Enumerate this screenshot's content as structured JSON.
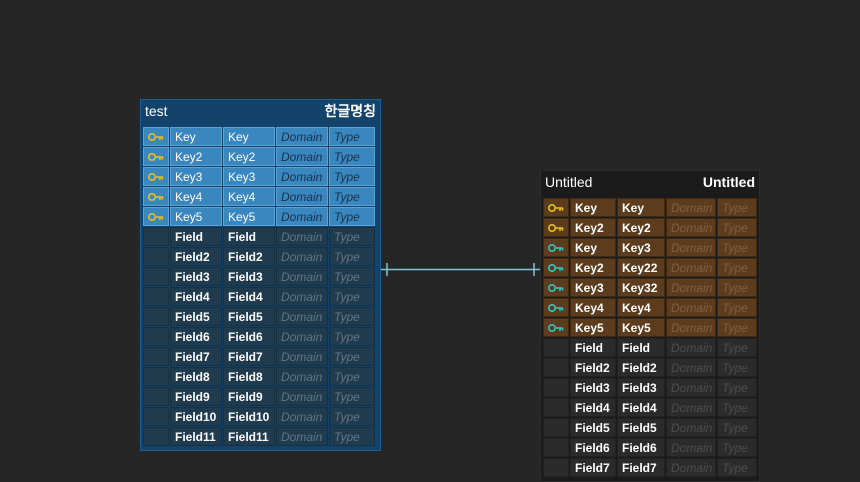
{
  "colors": {
    "background": "#262626",
    "relation_line": "#7ec6d6",
    "pk_key_icon": "#e6c21a",
    "fk_key_icon": "#2fc6c0",
    "selected_table": "#13436b",
    "pk_row_blue": "#3a86bf",
    "pk_row_brown": "#5c3c1c"
  },
  "tables": [
    {
      "name": "test",
      "comment": "한글명칭",
      "rows": [
        {
          "kind": "pk",
          "icon": "pk-key-icon",
          "logical": "Key",
          "physical": "Key",
          "domain": "Domain",
          "type": "Type"
        },
        {
          "kind": "pk",
          "icon": "pk-key-icon",
          "logical": "Key2",
          "physical": "Key2",
          "domain": "Domain",
          "type": "Type"
        },
        {
          "kind": "pk",
          "icon": "pk-key-icon",
          "logical": "Key3",
          "physical": "Key3",
          "domain": "Domain",
          "type": "Type"
        },
        {
          "kind": "pk",
          "icon": "pk-key-icon",
          "logical": "Key4",
          "physical": "Key4",
          "domain": "Domain",
          "type": "Type"
        },
        {
          "kind": "pk",
          "icon": "pk-key-icon",
          "logical": "Key5",
          "physical": "Key5",
          "domain": "Domain",
          "type": "Type"
        },
        {
          "kind": "field",
          "icon": "",
          "logical": "Field",
          "physical": "Field",
          "domain": "Domain",
          "type": "Type"
        },
        {
          "kind": "field",
          "icon": "",
          "logical": "Field2",
          "physical": "Field2",
          "domain": "Domain",
          "type": "Type"
        },
        {
          "kind": "field",
          "icon": "",
          "logical": "Field3",
          "physical": "Field3",
          "domain": "Domain",
          "type": "Type"
        },
        {
          "kind": "field",
          "icon": "",
          "logical": "Field4",
          "physical": "Field4",
          "domain": "Domain",
          "type": "Type"
        },
        {
          "kind": "field",
          "icon": "",
          "logical": "Field5",
          "physical": "Field5",
          "domain": "Domain",
          "type": "Type"
        },
        {
          "kind": "field",
          "icon": "",
          "logical": "Field6",
          "physical": "Field6",
          "domain": "Domain",
          "type": "Type"
        },
        {
          "kind": "field",
          "icon": "",
          "logical": "Field7",
          "physical": "Field7",
          "domain": "Domain",
          "type": "Type"
        },
        {
          "kind": "field",
          "icon": "",
          "logical": "Field8",
          "physical": "Field8",
          "domain": "Domain",
          "type": "Type"
        },
        {
          "kind": "field",
          "icon": "",
          "logical": "Field9",
          "physical": "Field9",
          "domain": "Domain",
          "type": "Type"
        },
        {
          "kind": "field",
          "icon": "",
          "logical": "Field10",
          "physical": "Field10",
          "domain": "Domain",
          "type": "Type"
        },
        {
          "kind": "field",
          "icon": "",
          "logical": "Field11",
          "physical": "Field11",
          "domain": "Domain",
          "type": "Type"
        }
      ]
    },
    {
      "name": "Untitled",
      "comment": "Untitled",
      "rows": [
        {
          "kind": "pk",
          "icon": "pk-key-icon",
          "logical": "Key",
          "physical": "Key",
          "domain": "Domain",
          "type": "Type"
        },
        {
          "kind": "pk",
          "icon": "pk-key-icon",
          "logical": "Key2",
          "physical": "Key2",
          "domain": "Domain",
          "type": "Type"
        },
        {
          "kind": "pk",
          "icon": "pfk-key-icon",
          "logical": "Key",
          "physical": "Key3",
          "domain": "Domain",
          "type": "Type"
        },
        {
          "kind": "pk",
          "icon": "pfk-key-icon",
          "logical": "Key2",
          "physical": "Key22",
          "domain": "Domain",
          "type": "Type"
        },
        {
          "kind": "pk",
          "icon": "pfk-key-icon",
          "logical": "Key3",
          "physical": "Key32",
          "domain": "Domain",
          "type": "Type"
        },
        {
          "kind": "pk",
          "icon": "pfk-key-icon",
          "logical": "Key4",
          "physical": "Key4",
          "domain": "Domain",
          "type": "Type"
        },
        {
          "kind": "pk",
          "icon": "pfk-key-icon",
          "logical": "Key5",
          "physical": "Key5",
          "domain": "Domain",
          "type": "Type"
        },
        {
          "kind": "field",
          "icon": "",
          "logical": "Field",
          "physical": "Field",
          "domain": "Domain",
          "type": "Type"
        },
        {
          "kind": "field",
          "icon": "",
          "logical": "Field2",
          "physical": "Field2",
          "domain": "Domain",
          "type": "Type"
        },
        {
          "kind": "field",
          "icon": "",
          "logical": "Field3",
          "physical": "Field3",
          "domain": "Domain",
          "type": "Type"
        },
        {
          "kind": "field",
          "icon": "",
          "logical": "Field4",
          "physical": "Field4",
          "domain": "Domain",
          "type": "Type"
        },
        {
          "kind": "field",
          "icon": "",
          "logical": "Field5",
          "physical": "Field5",
          "domain": "Domain",
          "type": "Type"
        },
        {
          "kind": "field",
          "icon": "",
          "logical": "Field6",
          "physical": "Field6",
          "domain": "Domain",
          "type": "Type"
        },
        {
          "kind": "field",
          "icon": "",
          "logical": "Field7",
          "physical": "Field7",
          "domain": "Domain",
          "type": "Type"
        }
      ]
    }
  ],
  "relation": {
    "from": "test",
    "to": "Untitled",
    "notation": "one-to-one"
  }
}
